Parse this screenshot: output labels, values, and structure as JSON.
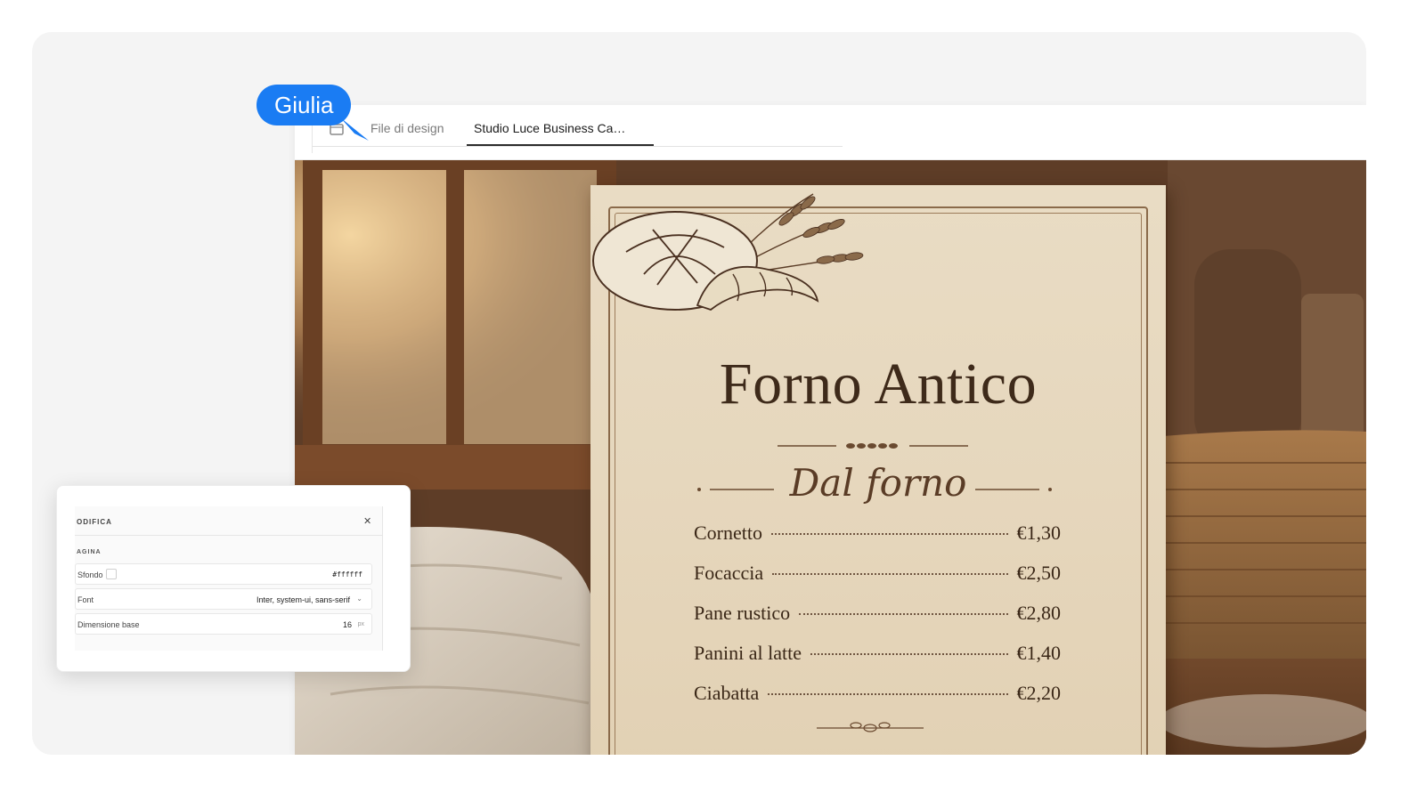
{
  "tabs": [
    {
      "label": "File di design",
      "active": false
    },
    {
      "label": "Studio Luce Business Ca…",
      "active": true
    }
  ],
  "cursor": {
    "user": "Giulia",
    "color": "#1a7cf3"
  },
  "menu": {
    "title": "Forno Antico",
    "subtitle": "Dal forno",
    "items": [
      {
        "name": "Cornetto",
        "price": "€1,30"
      },
      {
        "name": "Focaccia",
        "price": "€2,50"
      },
      {
        "name": "Pane rustico",
        "price": "€2,80"
      },
      {
        "name": "Panini al latte",
        "price": "€1,40"
      },
      {
        "name": "Ciabatta",
        "price": "€2,20"
      }
    ]
  },
  "edit_panel": {
    "title": "ODIFICA",
    "close_icon": "close-icon",
    "section": "AGINA",
    "props": {
      "background": {
        "label": "Sfondo",
        "value": "#ffffff"
      },
      "font": {
        "label": "Font",
        "value": "Inter, system-ui, sans-serif"
      },
      "base_size": {
        "label": "Dimensione base",
        "value": "16",
        "unit": "px"
      }
    }
  },
  "colors": {
    "accent": "#1a7cf3",
    "menu_ink": "#3e2a1a",
    "menu_paper": "#e6d7bd"
  }
}
